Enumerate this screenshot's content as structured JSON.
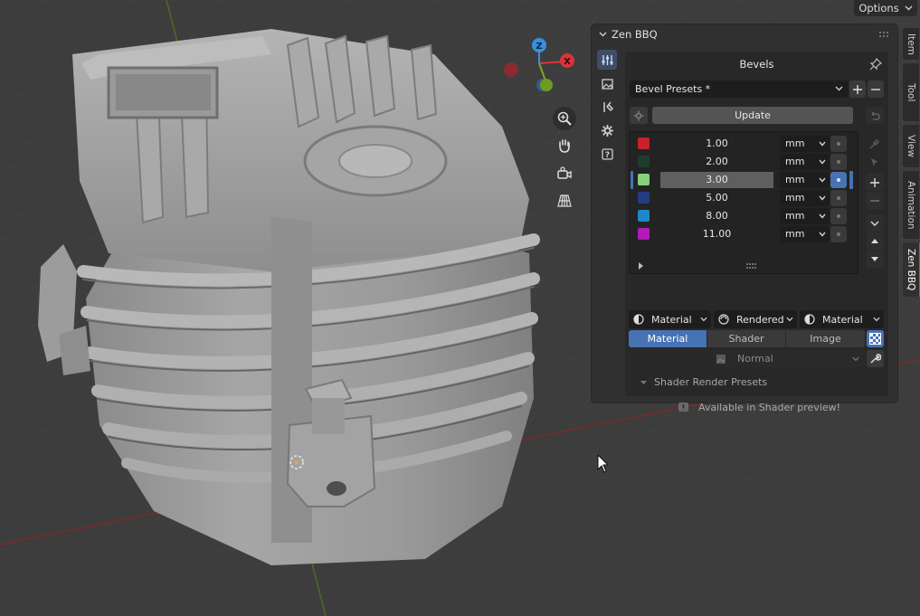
{
  "options": {
    "label": "Options"
  },
  "tabs": [
    "Item",
    "Tool",
    "View",
    "Animation",
    "Zen BBQ"
  ],
  "panel": {
    "title": "Zen BBQ",
    "subtitle": "Bevels"
  },
  "presets": {
    "label": "Bevel Presets *"
  },
  "update": {
    "label": "Update"
  },
  "bevels": [
    {
      "color": "#c8202c",
      "value": "1.00",
      "unit": "mm"
    },
    {
      "color": "#1f3d2c",
      "value": "2.00",
      "unit": "mm"
    },
    {
      "color": "#86d07a",
      "value": "3.00",
      "unit": "mm"
    },
    {
      "color": "#233d82",
      "value": "5.00",
      "unit": "mm"
    },
    {
      "color": "#1f86c8",
      "value": "8.00",
      "unit": "mm"
    },
    {
      "color": "#b01ab8",
      "value": "11.00",
      "unit": "mm"
    }
  ],
  "shading": {
    "left": "Material",
    "center": "Rendered",
    "right": "Material"
  },
  "modes": [
    "Material",
    "Shader",
    "Image"
  ],
  "normal": {
    "label": "Normal"
  },
  "shader_presets": {
    "label": "Shader Render Presets"
  },
  "notice": {
    "label": "Available in Shader preview!"
  },
  "colors": {
    "accent": "#4772b3",
    "axis_x": "#d8343c",
    "axis_y": "#7ca82c",
    "axis_z": "#3a8fdc"
  }
}
